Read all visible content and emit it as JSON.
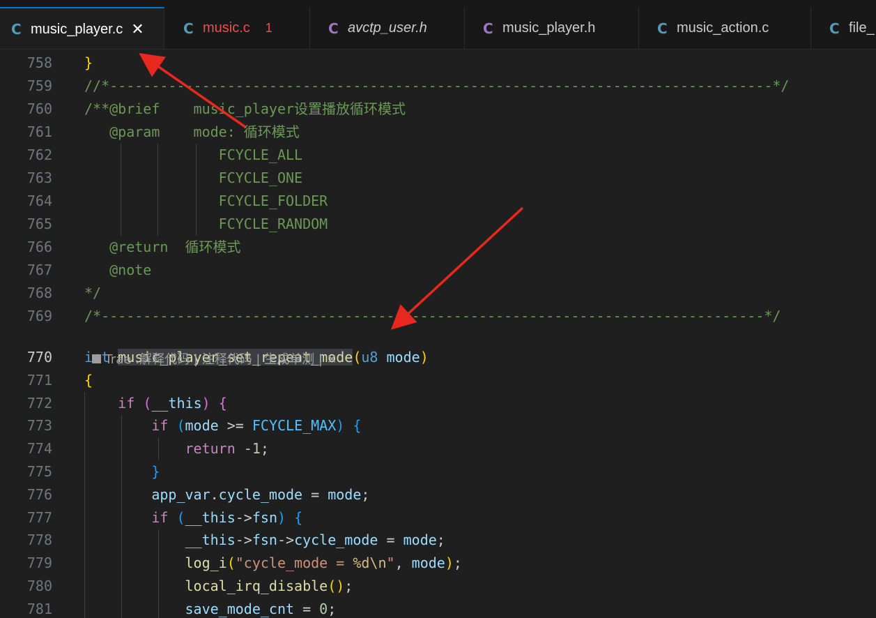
{
  "tabs": [
    {
      "icon": "C",
      "name": "music_player.c",
      "close": "✕"
    },
    {
      "icon": "C",
      "name": "music.c",
      "badge": "1"
    },
    {
      "icon": "C",
      "name": "avctp_user.h"
    },
    {
      "icon": "C",
      "name": "music_player.h"
    },
    {
      "icon": "C",
      "name": "music_action.c"
    },
    {
      "icon": "C",
      "name": "file_"
    }
  ],
  "colors": {
    "editor_bg": "#1f1f1f",
    "tab_active_border": "#0078d4",
    "c_icon": "#519aba",
    "header_icon": "#a074c4",
    "error": "#f14c4c",
    "annotation_arrow": "#e8281e"
  },
  "editor": {
    "current_line": "770",
    "codelens": {
      "label": "Trae :解释代码 | 注释代码 | 生成单测 | ",
      "close": "✕"
    },
    "lines": [
      {
        "n": "758",
        "tokens": [
          {
            "t": "}",
            "c": "b1"
          }
        ]
      },
      {
        "n": "759",
        "tokens": [
          {
            "t": "//*-------------------------------------------------------------------------------*/",
            "c": "com"
          }
        ]
      },
      {
        "n": "760",
        "tokens": [
          {
            "t": "/**@brief    music_player设置播放循环模式",
            "c": "com"
          }
        ]
      },
      {
        "n": "761",
        "tokens": [
          {
            "t": "   @param    mode: 循环模式",
            "c": "com"
          }
        ]
      },
      {
        "n": "762",
        "tokens": [
          {
            "t": "                FCYCLE_ALL",
            "c": "com"
          }
        ]
      },
      {
        "n": "763",
        "tokens": [
          {
            "t": "                FCYCLE_ONE",
            "c": "com"
          }
        ]
      },
      {
        "n": "764",
        "tokens": [
          {
            "t": "                FCYCLE_FOLDER",
            "c": "com"
          }
        ]
      },
      {
        "n": "765",
        "tokens": [
          {
            "t": "                FCYCLE_RANDOM",
            "c": "com"
          }
        ]
      },
      {
        "n": "766",
        "tokens": [
          {
            "t": "   @return  循环模式",
            "c": "com"
          }
        ]
      },
      {
        "n": "767",
        "tokens": [
          {
            "t": "   @note",
            "c": "com"
          }
        ]
      },
      {
        "n": "768",
        "tokens": [
          {
            "t": "*/",
            "c": "com"
          }
        ]
      },
      {
        "n": "769",
        "tokens": [
          {
            "t": "/*-------------------------------------------------------------------------------*/",
            "c": "com"
          }
        ]
      },
      {
        "n": "770",
        "tokens": [
          {
            "t": "int",
            "c": "kw"
          },
          {
            "t": " ",
            "c": "pun"
          },
          {
            "t": "music_player_set_repeat_mode",
            "c": "fn",
            "hl": true
          },
          {
            "t": "(",
            "c": "b1"
          },
          {
            "t": "u8",
            "c": "kw"
          },
          {
            "t": " ",
            "c": "pun"
          },
          {
            "t": "mode",
            "c": "var"
          },
          {
            "t": ")",
            "c": "b1"
          }
        ]
      },
      {
        "n": "771",
        "tokens": [
          {
            "t": "{",
            "c": "b1"
          }
        ]
      },
      {
        "n": "772",
        "tokens": [
          {
            "t": "    ",
            "c": "pun"
          },
          {
            "t": "if",
            "c": "ctl"
          },
          {
            "t": " ",
            "c": "pun"
          },
          {
            "t": "(",
            "c": "b2"
          },
          {
            "t": "__this",
            "c": "var"
          },
          {
            "t": ")",
            "c": "b2"
          },
          {
            "t": " ",
            "c": "pun"
          },
          {
            "t": "{",
            "c": "b2"
          }
        ]
      },
      {
        "n": "773",
        "tokens": [
          {
            "t": "        ",
            "c": "pun"
          },
          {
            "t": "if",
            "c": "ctl"
          },
          {
            "t": " ",
            "c": "pun"
          },
          {
            "t": "(",
            "c": "b3"
          },
          {
            "t": "mode",
            "c": "var"
          },
          {
            "t": " >= ",
            "c": "pun"
          },
          {
            "t": "FCYCLE_MAX",
            "c": "const"
          },
          {
            "t": ")",
            "c": "b3"
          },
          {
            "t": " ",
            "c": "pun"
          },
          {
            "t": "{",
            "c": "b3"
          }
        ]
      },
      {
        "n": "774",
        "tokens": [
          {
            "t": "            ",
            "c": "pun"
          },
          {
            "t": "return",
            "c": "ctl"
          },
          {
            "t": " -",
            "c": "pun"
          },
          {
            "t": "1",
            "c": "num"
          },
          {
            "t": ";",
            "c": "pun"
          }
        ]
      },
      {
        "n": "775",
        "tokens": [
          {
            "t": "        ",
            "c": "pun"
          },
          {
            "t": "}",
            "c": "b3"
          }
        ]
      },
      {
        "n": "776",
        "tokens": [
          {
            "t": "        ",
            "c": "pun"
          },
          {
            "t": "app_var",
            "c": "var"
          },
          {
            "t": ".",
            "c": "pun"
          },
          {
            "t": "cycle_mode",
            "c": "var"
          },
          {
            "t": " = ",
            "c": "pun"
          },
          {
            "t": "mode",
            "c": "var"
          },
          {
            "t": ";",
            "c": "pun"
          }
        ]
      },
      {
        "n": "777",
        "tokens": [
          {
            "t": "        ",
            "c": "pun"
          },
          {
            "t": "if",
            "c": "ctl"
          },
          {
            "t": " ",
            "c": "pun"
          },
          {
            "t": "(",
            "c": "b3"
          },
          {
            "t": "__this",
            "c": "var"
          },
          {
            "t": "->",
            "c": "pun"
          },
          {
            "t": "fsn",
            "c": "var"
          },
          {
            "t": ")",
            "c": "b3"
          },
          {
            "t": " ",
            "c": "pun"
          },
          {
            "t": "{",
            "c": "b3"
          }
        ]
      },
      {
        "n": "778",
        "tokens": [
          {
            "t": "            ",
            "c": "pun"
          },
          {
            "t": "__this",
            "c": "var"
          },
          {
            "t": "->",
            "c": "pun"
          },
          {
            "t": "fsn",
            "c": "var"
          },
          {
            "t": "->",
            "c": "pun"
          },
          {
            "t": "cycle_mode",
            "c": "var"
          },
          {
            "t": " = ",
            "c": "pun"
          },
          {
            "t": "mode",
            "c": "var"
          },
          {
            "t": ";",
            "c": "pun"
          }
        ]
      },
      {
        "n": "779",
        "tokens": [
          {
            "t": "            ",
            "c": "pun"
          },
          {
            "t": "log_i",
            "c": "fn"
          },
          {
            "t": "(",
            "c": "b1"
          },
          {
            "t": "\"cycle_mode = ",
            "c": "str"
          },
          {
            "t": "%d\\n",
            "c": "esc"
          },
          {
            "t": "\"",
            "c": "str"
          },
          {
            "t": ", ",
            "c": "pun"
          },
          {
            "t": "mode",
            "c": "var"
          },
          {
            "t": ")",
            "c": "b1"
          },
          {
            "t": ";",
            "c": "pun"
          }
        ]
      },
      {
        "n": "780",
        "tokens": [
          {
            "t": "            ",
            "c": "pun"
          },
          {
            "t": "local_irq_disable",
            "c": "fn"
          },
          {
            "t": "()",
            "c": "b1"
          },
          {
            "t": ";",
            "c": "pun"
          }
        ]
      },
      {
        "n": "781",
        "tokens": [
          {
            "t": "            ",
            "c": "pun"
          },
          {
            "t": "save_mode_cnt",
            "c": "var"
          },
          {
            "t": " = ",
            "c": "pun"
          },
          {
            "t": "0",
            "c": "num"
          },
          {
            "t": ";",
            "c": "pun"
          }
        ]
      }
    ]
  }
}
